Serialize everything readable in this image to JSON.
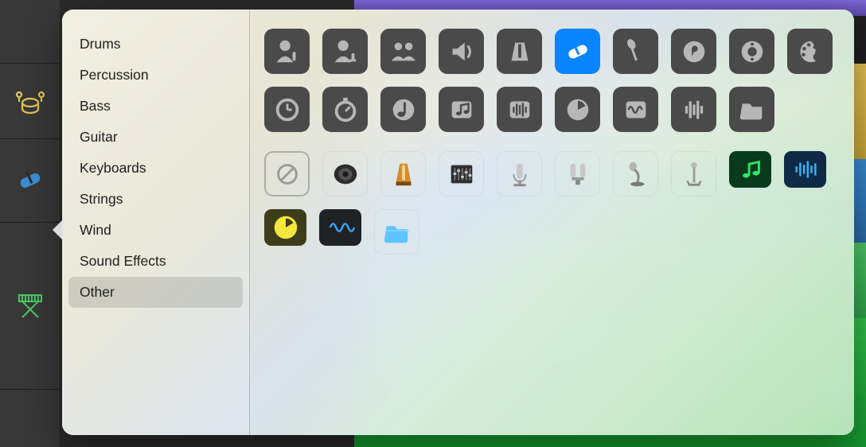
{
  "sidebar": {
    "categories": [
      {
        "label": "Drums"
      },
      {
        "label": "Percussion"
      },
      {
        "label": "Bass"
      },
      {
        "label": "Guitar"
      },
      {
        "label": "Keyboards"
      },
      {
        "label": "Strings"
      },
      {
        "label": "Wind"
      },
      {
        "label": "Sound Effects"
      },
      {
        "label": "Other"
      }
    ],
    "selected_index": 8
  },
  "tracks": [
    {
      "icon": "drums",
      "color": "#e6c557"
    },
    {
      "icon": "capsule",
      "color": "#3b8ed6"
    },
    {
      "icon": "keyboard",
      "color": "#4ec969"
    }
  ],
  "icon_palette": {
    "selected_index": 5,
    "row1": [
      "person-mic",
      "person-mic-alt",
      "group",
      "speaker",
      "metronome",
      "capsule",
      "mic-stand",
      "music-disc",
      "midi-plug",
      "palette"
    ],
    "row2": [
      "clock",
      "stopwatch",
      "note",
      "music-note-box",
      "waveform-box",
      "timer",
      "wave-square",
      "bars",
      "folder"
    ],
    "row3": [
      "disabled",
      "speaker-realistic",
      "metronome-realistic",
      "mixer",
      "condenser-mic",
      "stereo-mic",
      "desk-mic",
      "mic-stand-tall",
      "music-note-green",
      "waveform-blue"
    ],
    "row4": [
      "clock-yellow",
      "wave-dark",
      "folder-blue"
    ]
  }
}
